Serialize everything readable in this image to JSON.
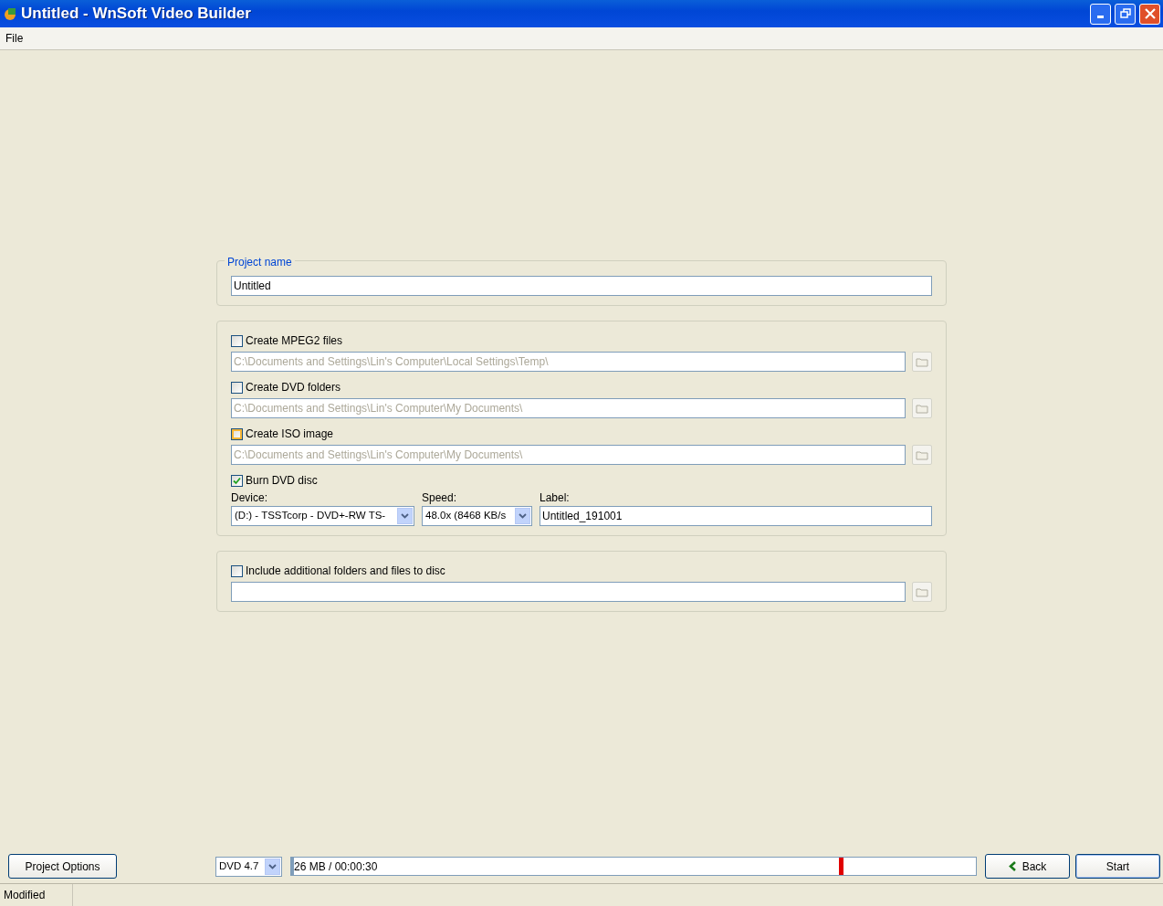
{
  "window": {
    "title": "Untitled - WnSoft Video Builder"
  },
  "menu": [
    "File"
  ],
  "project_name": {
    "legend": "Project name",
    "value": "Untitled"
  },
  "outputs": [
    {
      "label": "Create MPEG2 files",
      "checked": false,
      "hovered": false,
      "path": "C:\\Documents and Settings\\Lin's Computer\\Local Settings\\Temp\\"
    },
    {
      "label": "Create DVD folders",
      "checked": false,
      "hovered": false,
      "path": "C:\\Documents and Settings\\Lin's Computer\\My Documents\\"
    },
    {
      "label": "Create ISO image",
      "checked": false,
      "hovered": true,
      "path": "C:\\Documents and Settings\\Lin's Computer\\My Documents\\"
    }
  ],
  "burn": {
    "label": "Burn DVD disc",
    "checked": true,
    "device_label": "Device:",
    "device": "(D:) - TSSTcorp - DVD+-RW TS-",
    "speed_label": "Speed:",
    "speed": "48.0x (8468 KB/s",
    "label_label": "Label:",
    "label_value": "Untitled_191001"
  },
  "include": {
    "label": "Include additional folders and files to disc",
    "checked": false,
    "hovered": false
  },
  "bottom": {
    "project_options": "Project Options",
    "disc": "DVD 4.7",
    "usage": "26 MB / 00:00:30",
    "level": 0.004,
    "back": "Back",
    "start": "Start"
  },
  "status_bar": [
    "Modified"
  ]
}
